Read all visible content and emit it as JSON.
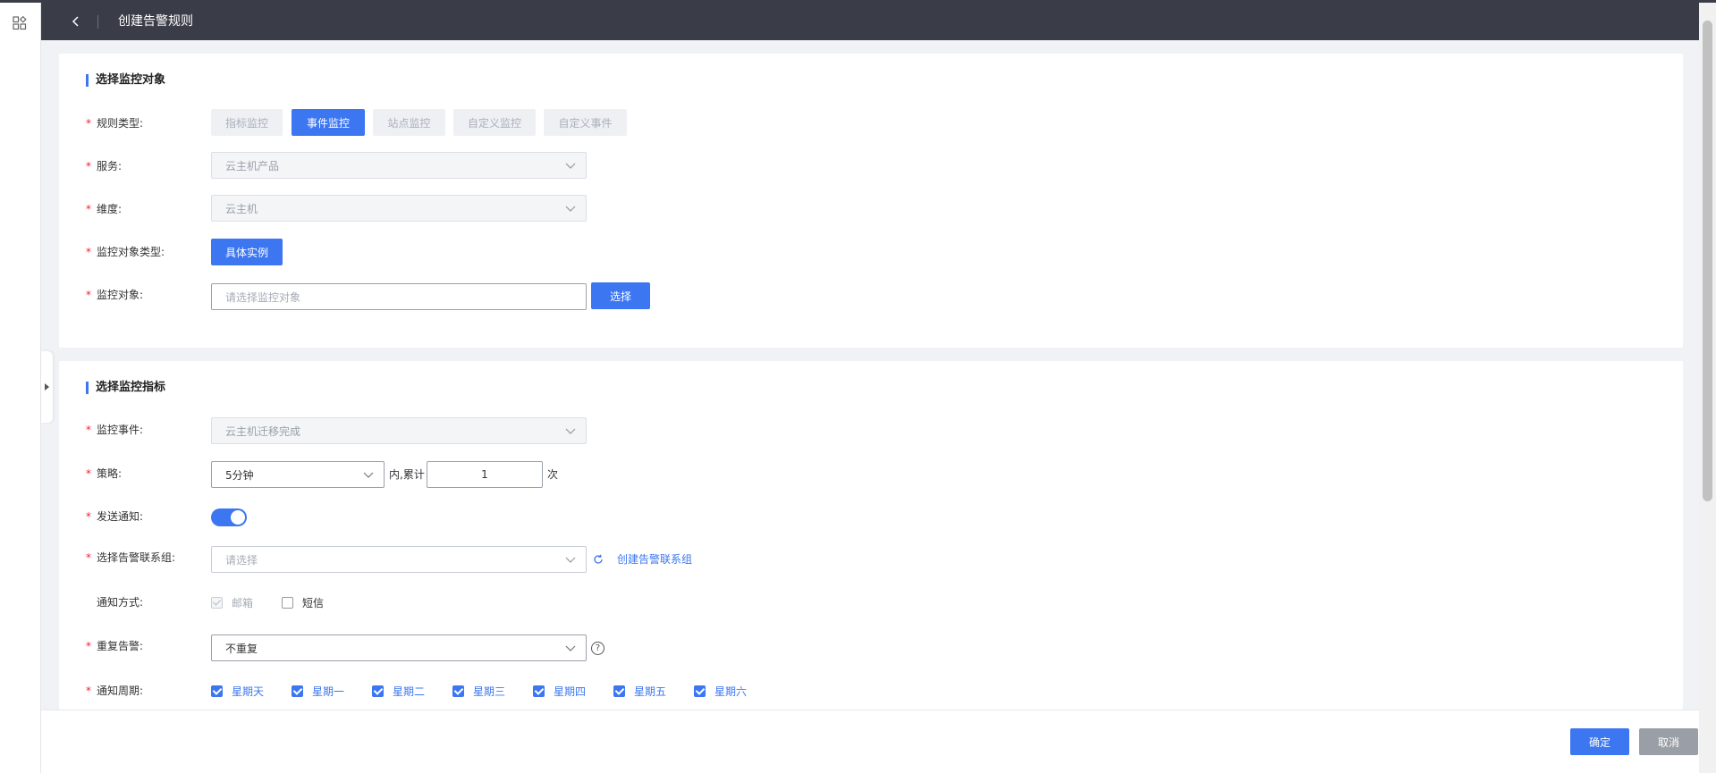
{
  "header": {
    "title": "创建告警规则",
    "back_icon": "chevron-left-icon"
  },
  "rail": {
    "icon": "apps-grid-icon"
  },
  "section1": {
    "title": "选择监控对象",
    "rule_type": {
      "label": "规则类型:",
      "options": [
        "指标监控",
        "事件监控",
        "站点监控",
        "自定义监控",
        "自定义事件"
      ],
      "selected": "事件监控"
    },
    "service": {
      "label": "服务:",
      "value": "云主机产品"
    },
    "dimension": {
      "label": "维度:",
      "value": "云主机"
    },
    "object_type": {
      "label": "监控对象类型:",
      "value": "具体实例"
    },
    "object": {
      "label": "监控对象:",
      "placeholder": "请选择监控对象",
      "button": "选择"
    }
  },
  "section2": {
    "title": "选择监控指标",
    "event": {
      "label": "监控事件:",
      "value": "云主机迁移完成"
    },
    "strategy": {
      "label": "策略:",
      "period": "5分钟",
      "mid_text": "内,累计",
      "count": "1",
      "unit": "次"
    },
    "notify": {
      "label": "发送通知:",
      "enabled": true
    },
    "contact_group": {
      "label": "选择告警联系组:",
      "placeholder": "请选择",
      "create_link": "创建告警联系组"
    },
    "method": {
      "label": "通知方式:",
      "email": "邮箱",
      "sms": "短信"
    },
    "repeat": {
      "label": "重复告警:",
      "value": "不重复",
      "help": "?"
    },
    "cycle": {
      "label": "通知周期:",
      "days": [
        "星期天",
        "星期一",
        "星期二",
        "星期三",
        "星期四",
        "星期五",
        "星期六"
      ]
    }
  },
  "footer": {
    "ok": "确定",
    "cancel": "取消"
  },
  "colors": {
    "accent": "#3c76f1",
    "header_bg": "#3a3d47",
    "required": "#f5222d"
  }
}
